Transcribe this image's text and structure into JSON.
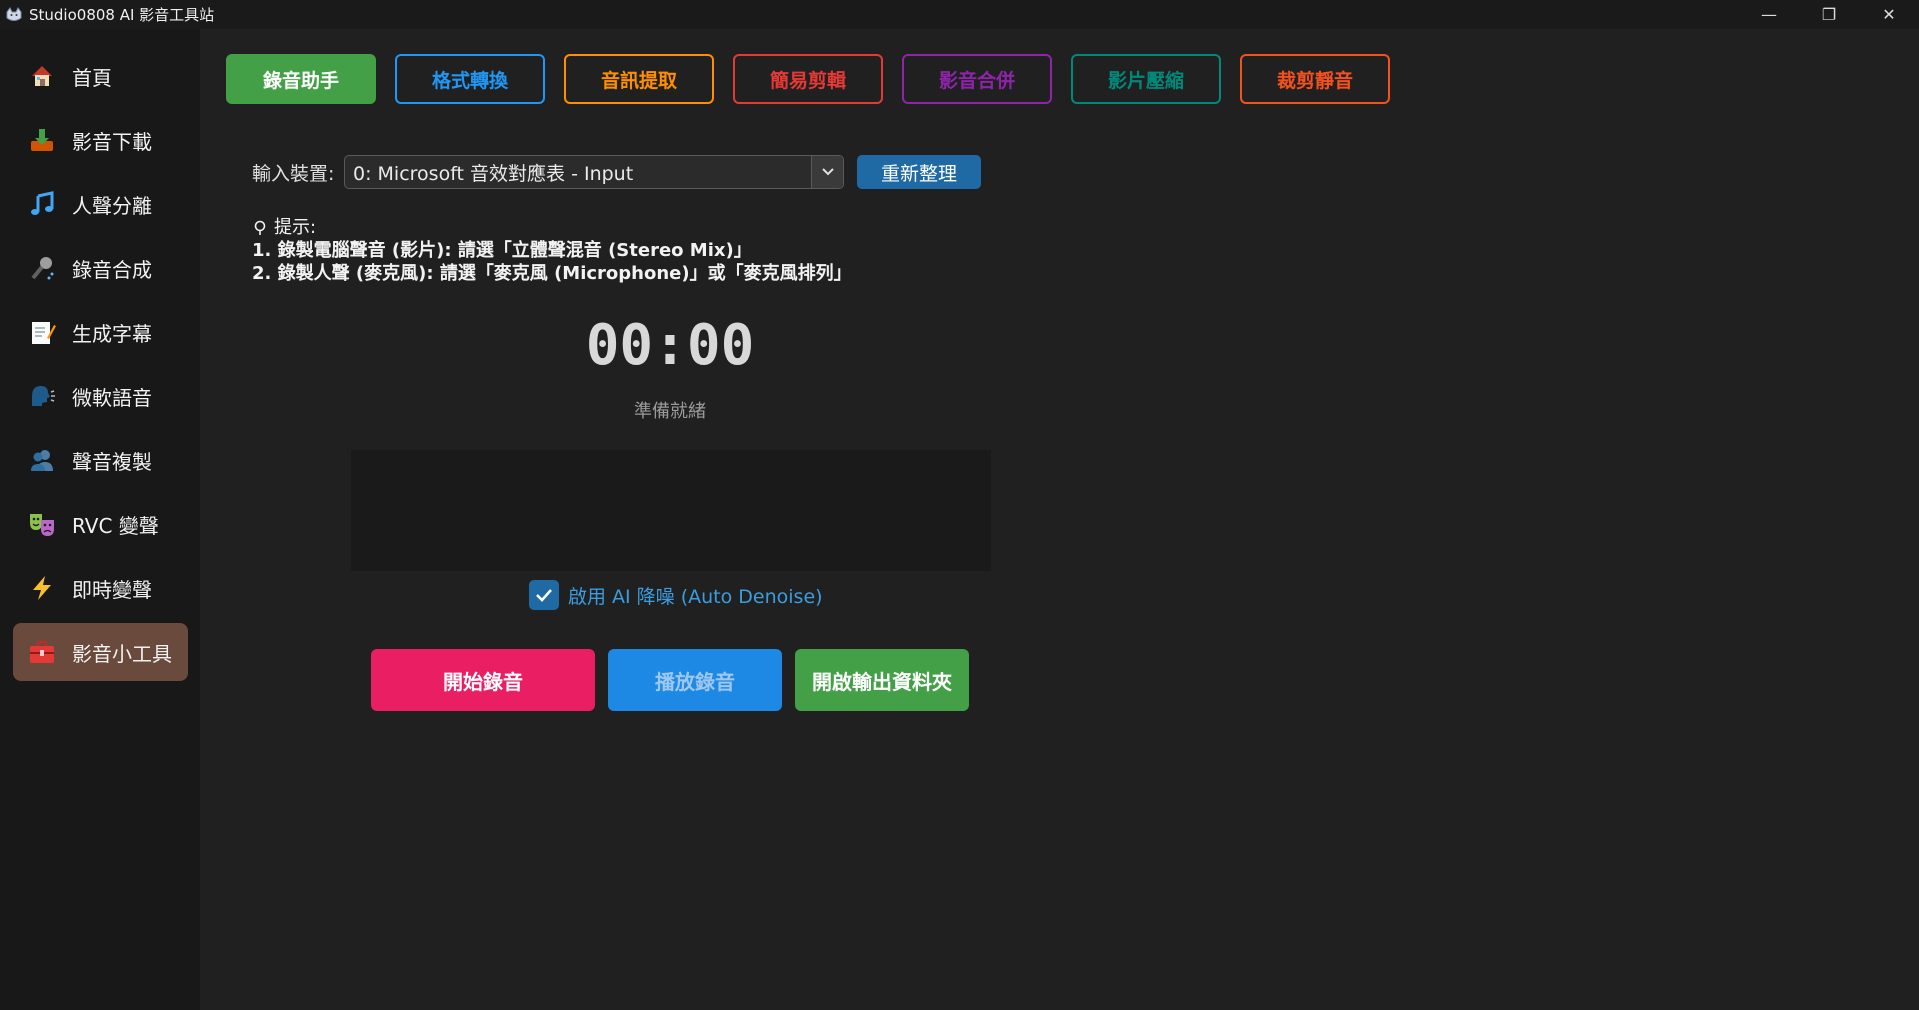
{
  "window": {
    "title": "Studio0808 AI 影音工具站",
    "controls": [
      "—",
      "❐",
      "✕"
    ]
  },
  "sidebar": {
    "items": [
      {
        "label": "首頁",
        "icon": "house-icon"
      },
      {
        "label": "影音下載",
        "icon": "download-tray-icon"
      },
      {
        "label": "人聲分離",
        "icon": "music-note-icon"
      },
      {
        "label": "錄音合成",
        "icon": "microphone-icon"
      },
      {
        "label": "生成字幕",
        "icon": "memo-icon"
      },
      {
        "label": "微軟語音",
        "icon": "speaking-head-icon"
      },
      {
        "label": "聲音複製",
        "icon": "people-icon"
      },
      {
        "label": "RVC 變聲",
        "icon": "theater-masks-icon"
      },
      {
        "label": "即時變聲",
        "icon": "lightning-icon"
      },
      {
        "label": "影音小工具",
        "icon": "toolbox-icon",
        "active": true
      }
    ]
  },
  "tabs": [
    {
      "label": "錄音助手",
      "color": "#43a047",
      "active": true
    },
    {
      "label": "格式轉換",
      "color": "#2196f3"
    },
    {
      "label": "音訊提取",
      "color": "#ff8f00"
    },
    {
      "label": "簡易剪輯",
      "color": "#e53935"
    },
    {
      "label": "影音合併",
      "color": "#8e24aa"
    },
    {
      "label": "影片壓縮",
      "color": "#00897b"
    },
    {
      "label": "裁剪靜音",
      "color": "#f4511e"
    }
  ],
  "device": {
    "label": "輸入裝置:",
    "selected": "0: Microsoft 音效對應表 - Input",
    "refresh_label": "重新整理"
  },
  "tips": {
    "title": "提示:",
    "line1": "1. 錄製電腦聲音 (影片): 請選「立體聲混音 (Stereo Mix)」",
    "line2": "2. 錄製人聲 (麥克風): 請選「麥克風 (Microphone)」或「麥克風排列」"
  },
  "recorder": {
    "timer": "00:00",
    "status": "準備就緒"
  },
  "denoise": {
    "label": "啟用 AI 降噪 (Auto Denoise)",
    "checked": true
  },
  "actions": {
    "start": {
      "label": "開始錄音",
      "color": "#e91e63"
    },
    "play": {
      "label": "播放錄音",
      "color": "#1e88e5",
      "disabled_text_color": "#9ec7ee"
    },
    "open_folder": {
      "label": "開啟輸出資料夾",
      "color": "#43a047"
    }
  }
}
